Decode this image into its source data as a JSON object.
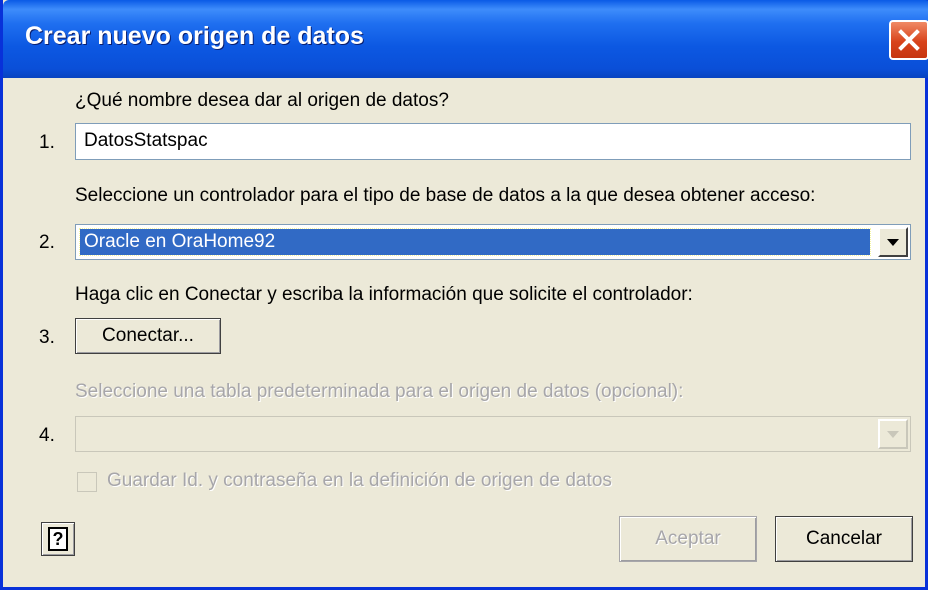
{
  "window": {
    "title": "Crear nuevo origen de datos"
  },
  "steps": {
    "step1": {
      "number": "1.",
      "prompt": "¿Qué nombre desea dar al origen de datos?",
      "value": "DatosStatspac"
    },
    "step2": {
      "number": "2.",
      "prompt": "Seleccione un controlador para el tipo de base de datos a la que desea obtener acceso:",
      "selected": "Oracle en OraHome92"
    },
    "step3": {
      "number": "3.",
      "prompt": "Haga clic en Conectar y escriba la información que solicite el controlador:",
      "button_label": "Conectar..."
    },
    "step4": {
      "number": "4.",
      "prompt": "Seleccione una tabla predeterminada para el origen de datos (opcional):",
      "selected": ""
    }
  },
  "save_credentials": {
    "label": "Guardar Id. y contraseña en la definición de origen de datos",
    "checked": false,
    "enabled": false
  },
  "footer": {
    "help_icon": "help-icon",
    "accept_label": "Aceptar",
    "cancel_label": "Cancelar"
  }
}
